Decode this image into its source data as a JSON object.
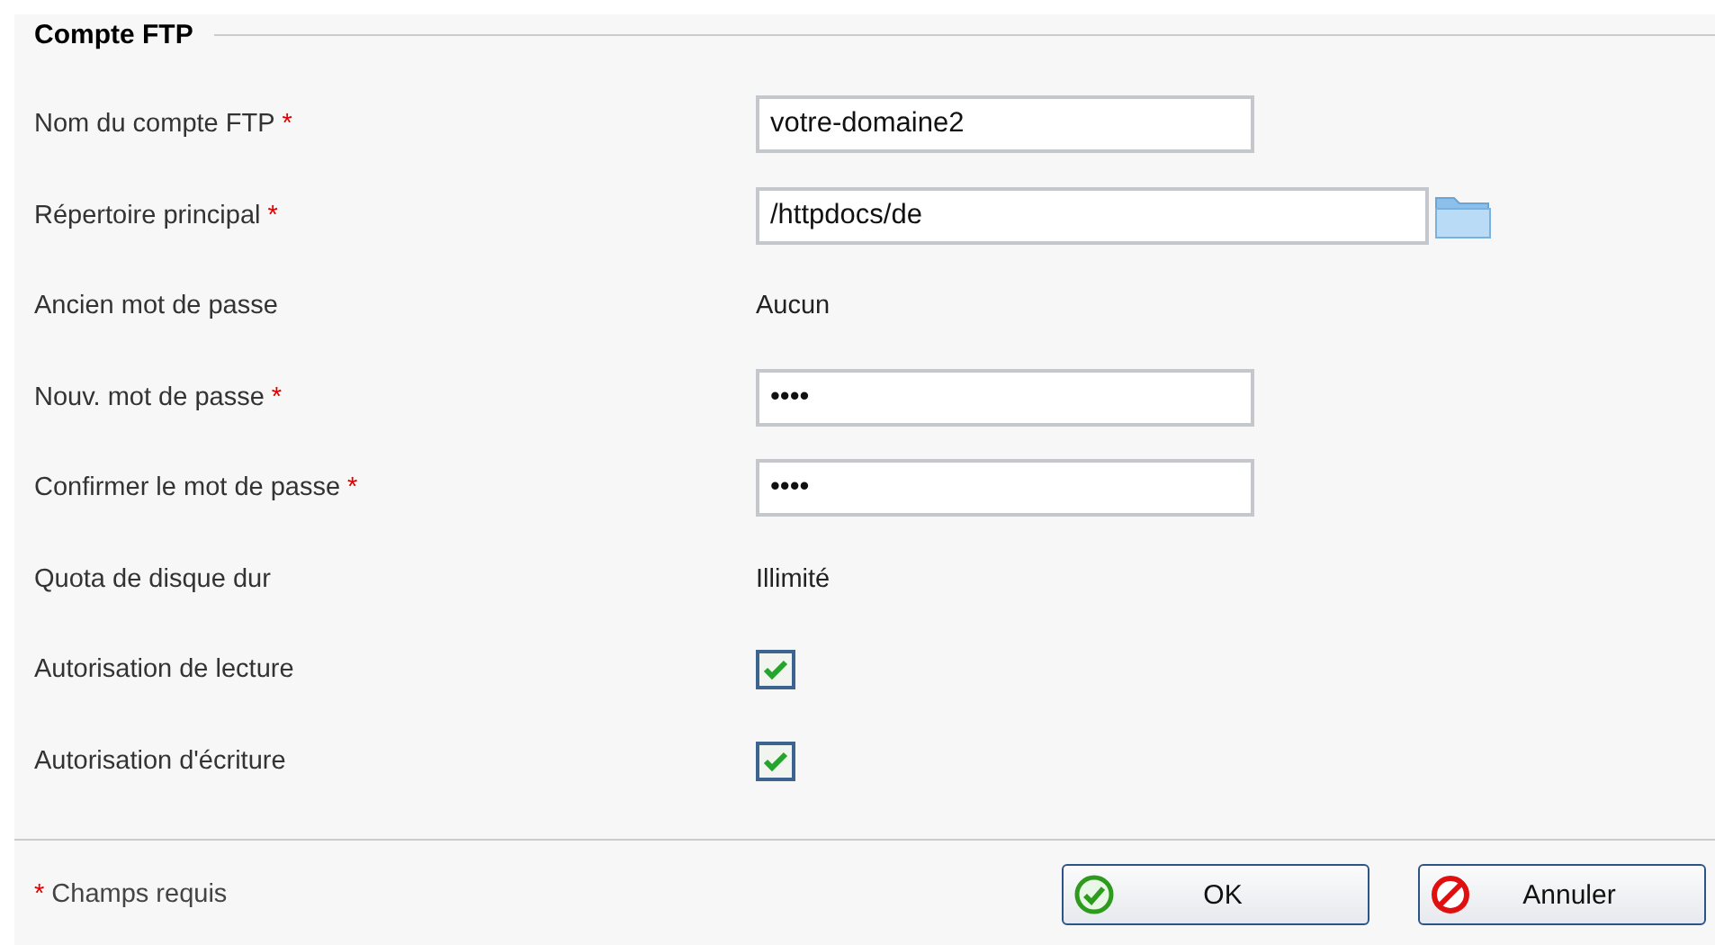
{
  "title": "Compte FTP",
  "rows": [
    {
      "kind": "text",
      "label": "Nom du compte FTP",
      "marker": "*",
      "value": "votre-domaine2"
    },
    {
      "kind": "folder",
      "label": "Répertoire principal",
      "marker": "*",
      "value": "/httpdocs/de"
    },
    {
      "kind": "static",
      "label": "Ancien mot de passe",
      "value": "Aucun"
    },
    {
      "kind": "text",
      "label": "Nouv. mot de passe",
      "marker": "*",
      "value": "••••"
    },
    {
      "kind": "text",
      "label": "Confirmer le mot de passe",
      "marker": "*",
      "value": "••••"
    },
    {
      "kind": "static",
      "label": "Quota de disque dur",
      "value": "Illimité"
    },
    {
      "kind": "checkbox",
      "label": "Autorisation de lecture",
      "checked": true
    },
    {
      "kind": "checkbox",
      "label": "Autorisation d'écriture",
      "checked": true
    }
  ],
  "note": {
    "marker": "*",
    "text": "Champs requis"
  },
  "buttons": [
    {
      "kind": "ok",
      "label": "OK"
    },
    {
      "kind": "cancel",
      "label": "Annuler"
    }
  ]
}
